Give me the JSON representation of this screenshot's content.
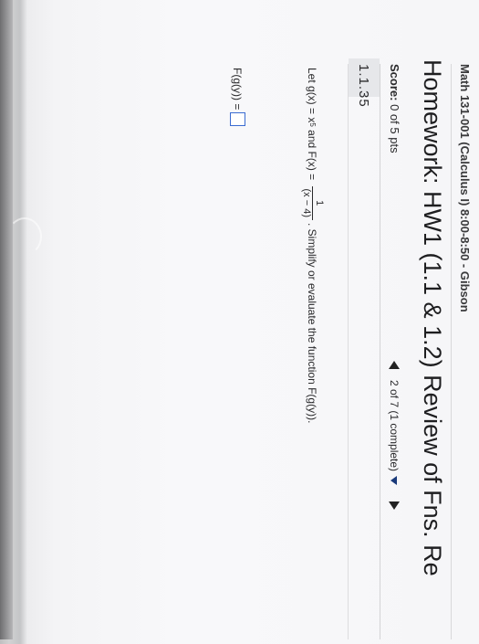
{
  "course": "Math 131-001 (Calculus I) 8:00-8:50 - Gibson",
  "homework_title": "Homework: HW1 (1.1 & 1.2) Review of Fns. Re",
  "score": {
    "label": "Score:",
    "value": "0 of 5 pts"
  },
  "navigation": {
    "position": "2 of 7 (1 complete)"
  },
  "question": {
    "number": "1.1.35",
    "prompt_start": "Let g(x) = x",
    "exponent": "5",
    "prompt_mid": " and F(x) = ",
    "frac_num": "1",
    "frac_den": "(x − 4)",
    "prompt_end": ". Simplify or evaluate the function F(g(y))."
  },
  "answer": {
    "label": "F(g(y)) ="
  },
  "icons": {
    "prev": "triangle-left-icon",
    "menu": "triangle-down-icon",
    "next": "triangle-right-icon"
  }
}
